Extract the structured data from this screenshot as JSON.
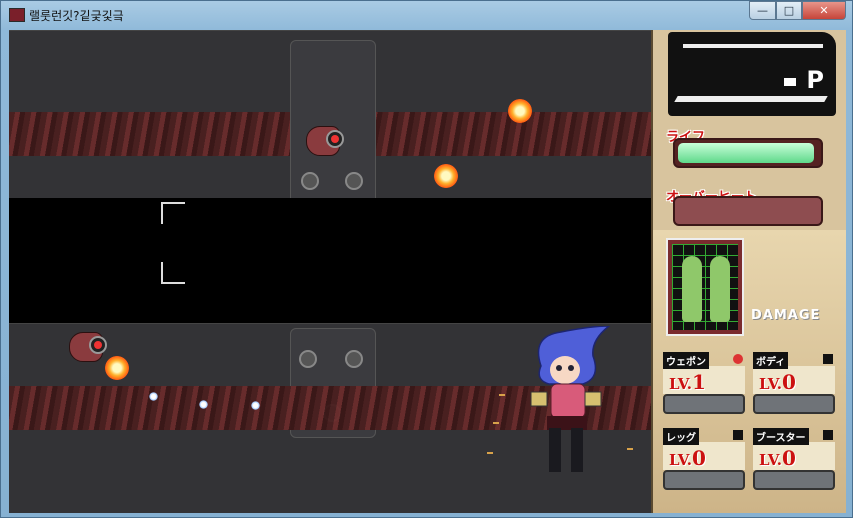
{
  "window": {
    "title": "랠룻런깃?깉긏깇긐",
    "ghost_tabs": "",
    "controls": {
      "minimize": "—",
      "maximize": "□",
      "close": "✕"
    }
  },
  "game": {
    "enemies": [
      {
        "name": "enemy-robot-upper"
      },
      {
        "name": "enemy-robot-lower"
      }
    ]
  },
  "hud": {
    "score_label": "P",
    "life_label": "ライフ",
    "life_fraction": 0.97,
    "overheat_label": "オーバーヒート",
    "overheat_fraction": 0.0,
    "damage_label": "DAMAGE",
    "slots": [
      {
        "label": "ウェポン",
        "lv_prefix": "LV.",
        "lv_value": "1"
      },
      {
        "label": "ボディ",
        "lv_prefix": "LV.",
        "lv_value": "0"
      },
      {
        "label": "レッグ",
        "lv_prefix": "LV.",
        "lv_value": "0"
      },
      {
        "label": "ブースター",
        "lv_prefix": "LV.",
        "lv_value": "0"
      }
    ],
    "colors": {
      "life": "#6fe39a",
      "panel": "#d8c49e",
      "accent_red": "#cc1111"
    }
  }
}
